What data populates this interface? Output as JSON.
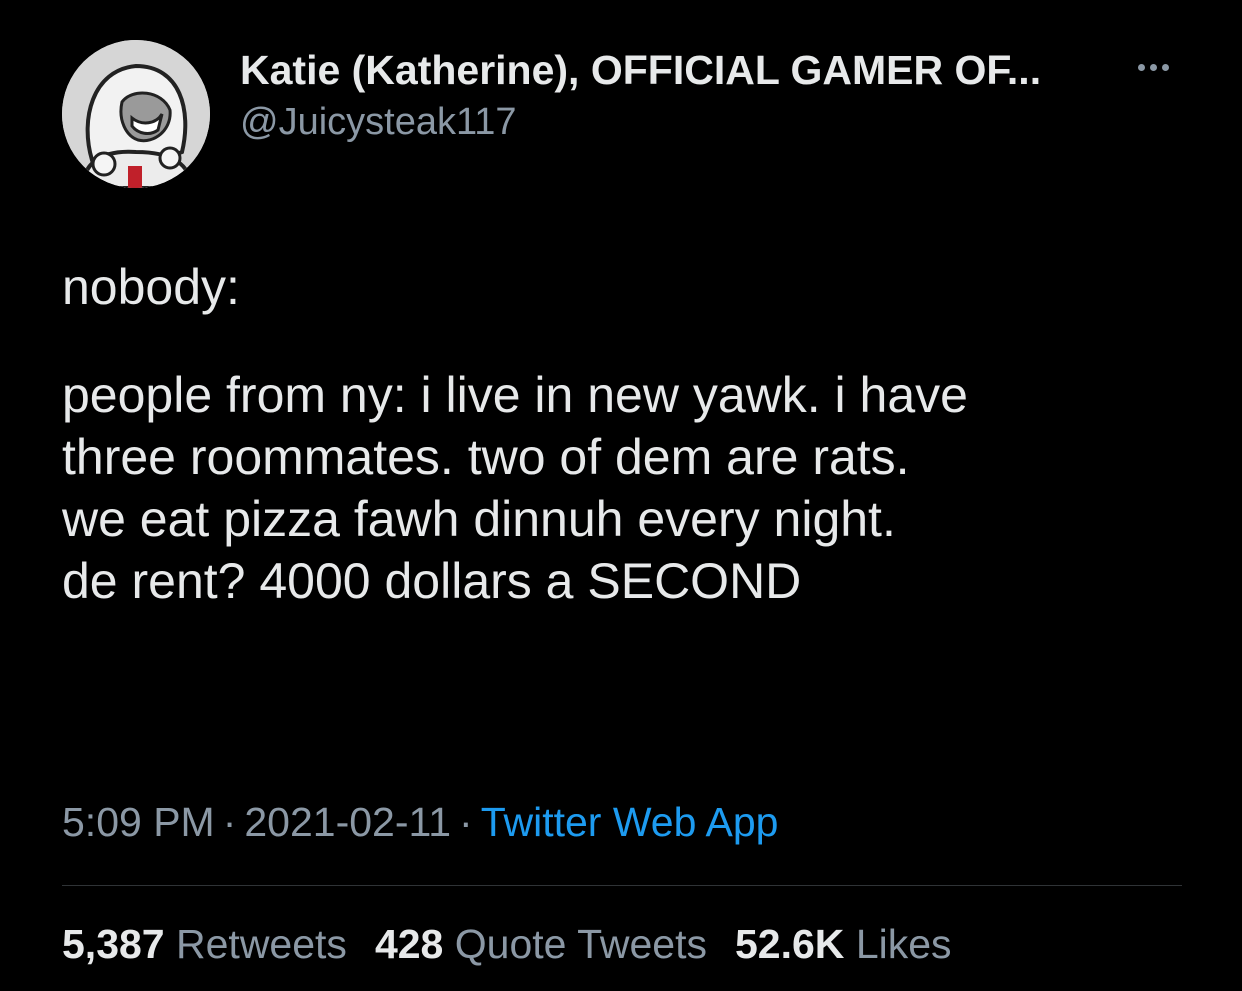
{
  "author": {
    "display_name": "Katie (Katherine), OFFICIAL GAMER OF...",
    "handle": "@Juicysteak117",
    "avatar_icon": "cartoon-avatar-icon"
  },
  "tweet": {
    "lines": [
      "nobody:",
      "people from ny: i live in new yawk. i have",
      "three roommates. two of dem are rats.",
      "we eat pizza fawh dinnuh every night.",
      "de rent? 4000 dollars a SECOND"
    ]
  },
  "meta": {
    "time": "5:09 PM",
    "date": "2021-02-11",
    "separator": "·",
    "source": "Twitter Web App"
  },
  "stats": {
    "retweets_count": "5,387",
    "retweets_label": "Retweets",
    "quotes_count": "428",
    "quotes_label": "Quote Tweets",
    "likes_count": "52.6K",
    "likes_label": "Likes"
  },
  "colors": {
    "background": "#000000",
    "primary_text": "#e7e9ea",
    "secondary_text": "#8b98a5",
    "link": "#1d9bf0",
    "divider": "#2f3336"
  }
}
